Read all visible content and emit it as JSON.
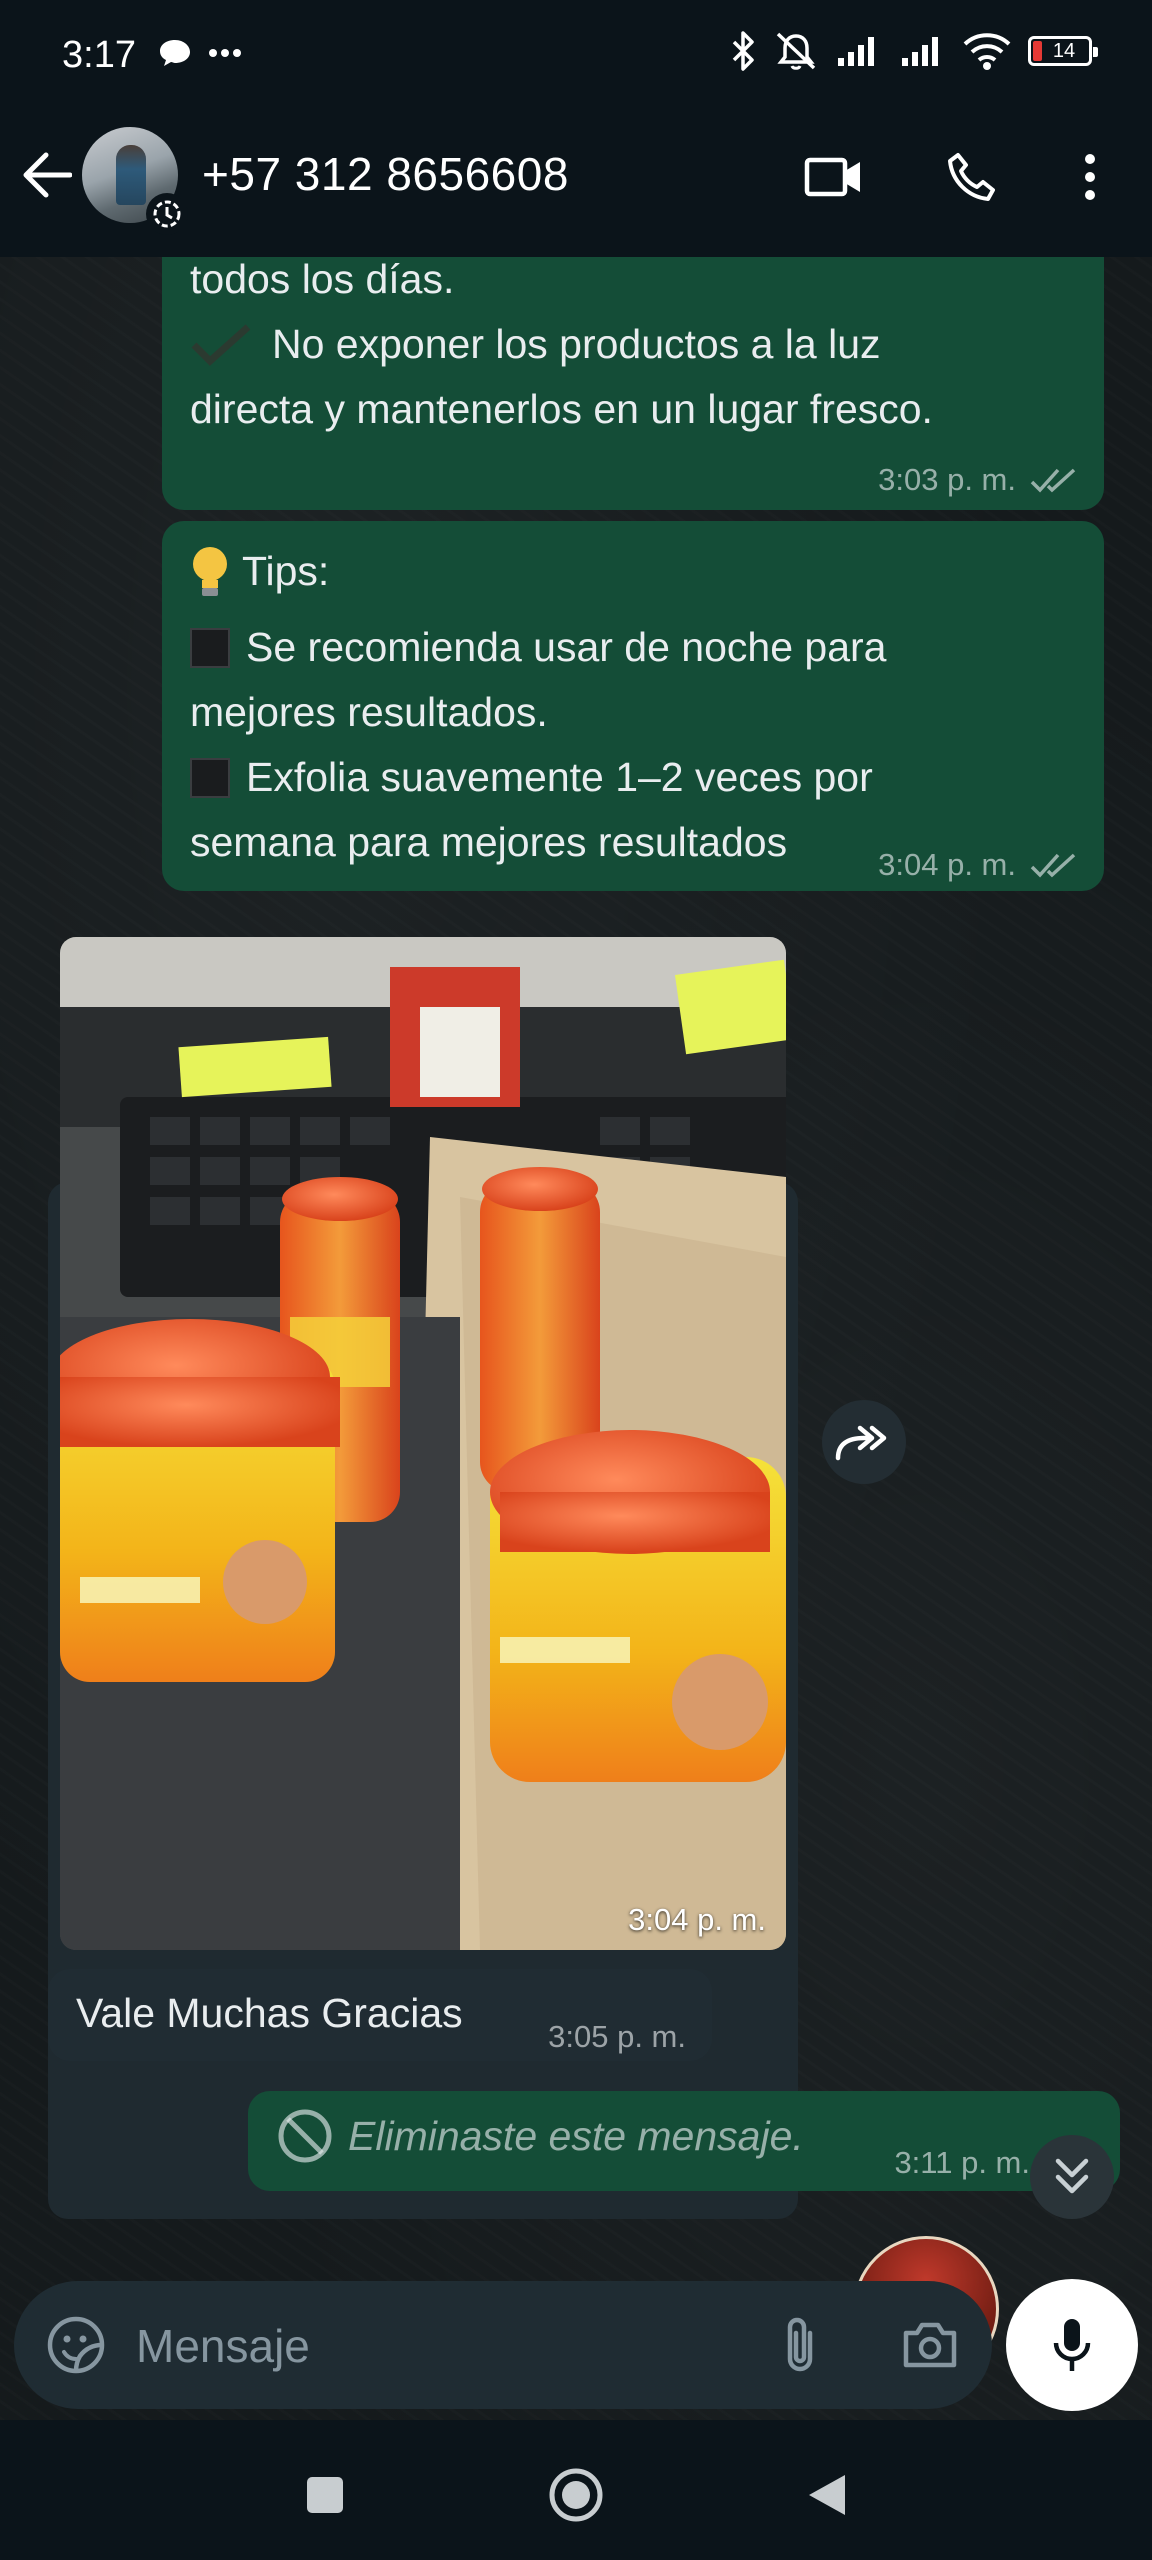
{
  "status_bar": {
    "time": "3:17",
    "battery_level": "14"
  },
  "header": {
    "contact_name": "+57 312 8656608"
  },
  "messages": {
    "m1": {
      "line1": "todos los días.",
      "line2": "No exponer los productos a la luz",
      "line3": "directa y mantenerlos en un lugar fresco.",
      "time": "3:03 p. m."
    },
    "m2": {
      "title": "Tips:",
      "line1": "Se recomienda usar de noche para",
      "line2": "mejores resultados.",
      "line3": "Exfolia suavemente 1–2 veces por",
      "line4": "semana para mejores resultados",
      "time": "3:04 p. m."
    },
    "m3": {
      "time": "3:04 p. m."
    },
    "m4": {
      "text": "Vale Muchas Gracias",
      "time": "3:05 p. m."
    },
    "m5": {
      "text": "Eliminaste este mensaje.",
      "time": "3:11 p. m."
    }
  },
  "composer": {
    "placeholder": "Mensaje"
  },
  "colors": {
    "outgoing_bubble": "#144d37",
    "incoming_bubble": "#202c33",
    "accent": "#53bdeb"
  },
  "icons": [
    "back-arrow-icon",
    "video-call-icon",
    "phone-icon",
    "more-vert-icon",
    "forward-icon",
    "scroll-down-icon",
    "emoji-icon",
    "attach-icon",
    "camera-icon",
    "mic-icon",
    "nav-recents-icon",
    "nav-home-icon",
    "nav-back-icon"
  ]
}
